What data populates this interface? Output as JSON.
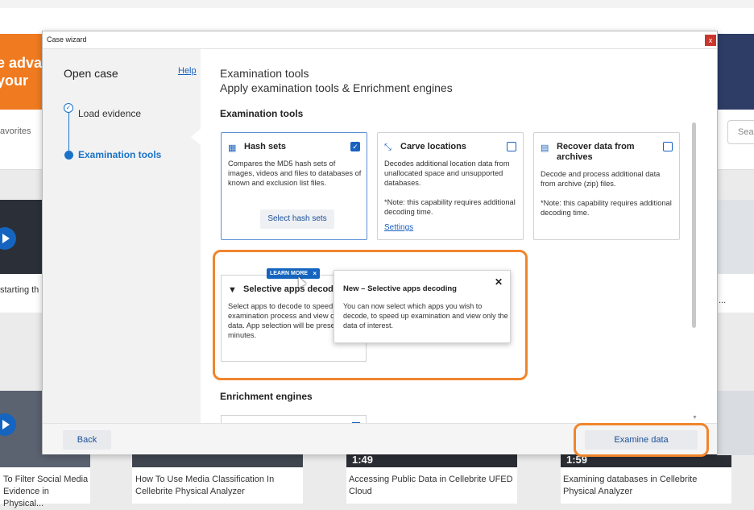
{
  "background_page": {
    "banner_text_line1": "e adva",
    "banner_text_line2": "your",
    "favorites_label": "avorites",
    "search_placeholder": "Sear",
    "row1_caption_left": "starting th",
    "row1_caption_right": "...",
    "videos": [
      {
        "caption": "To Filter Social Media Evidence in Physical...",
        "duration": ""
      },
      {
        "caption": "How To Use Media Classification In Cellebrite Physical Analyzer",
        "duration": ""
      },
      {
        "caption": "Accessing Public Data in Cellebrite UFED Cloud",
        "duration": "1:49"
      },
      {
        "caption": "Examining databases in Cellebrite Physical Analyzer",
        "duration": "1:59"
      }
    ]
  },
  "dialog": {
    "title": "Case wizard",
    "close_symbol": "x",
    "sidebar": {
      "title": "Open case",
      "help_label": "Help",
      "steps": [
        {
          "label": "Load evidence",
          "state": "done"
        },
        {
          "label": "Examination tools",
          "state": "active"
        }
      ]
    },
    "header": {
      "line1": "Examination tools",
      "line2": "Apply examination tools & Enrichment engines"
    },
    "examination_section_title": "Examination tools",
    "cards": [
      {
        "title": "Hash sets",
        "icon": "hash-sets-icon",
        "checked": true,
        "description": "Compares the MD5 hash sets of images, videos and files to databases of known and exclusion list files.",
        "button_label": "Select hash sets"
      },
      {
        "title": "Carve locations",
        "icon": "carve-icon",
        "checked": false,
        "description": "Decodes additional location data from unallocated space and unsupported databases.",
        "note": "*Note: this capability requires additional decoding time.",
        "link_label": "Settings"
      },
      {
        "title": "Recover data from archives",
        "icon": "archive-icon",
        "checked": false,
        "description": "Decode and process additional data from archive (zip) files.",
        "note": "*Note: this capability requires additional decoding time."
      }
    ],
    "selective_card": {
      "title": "Selective apps decodin",
      "icon": "filter-icon",
      "description": "Select apps to decode to speed u examination process and view or relevant data. App selection will be presented v few minutes."
    },
    "learn_more_badge": {
      "label": "LEARN MORE",
      "close": "×"
    },
    "popover": {
      "title": "New – Selective apps decoding",
      "close": "✕",
      "body": "You can now select which apps you wish to decode, to speed up examination and view only the data of interest."
    },
    "enrichment_section_title": "Enrichment engines",
    "footer": {
      "back_label": "Back",
      "examine_label": "Examine data"
    }
  },
  "colors": {
    "accent": "#1a62c0",
    "highlight": "#f0852d",
    "sidebar_bg": "#f2f2f2"
  }
}
